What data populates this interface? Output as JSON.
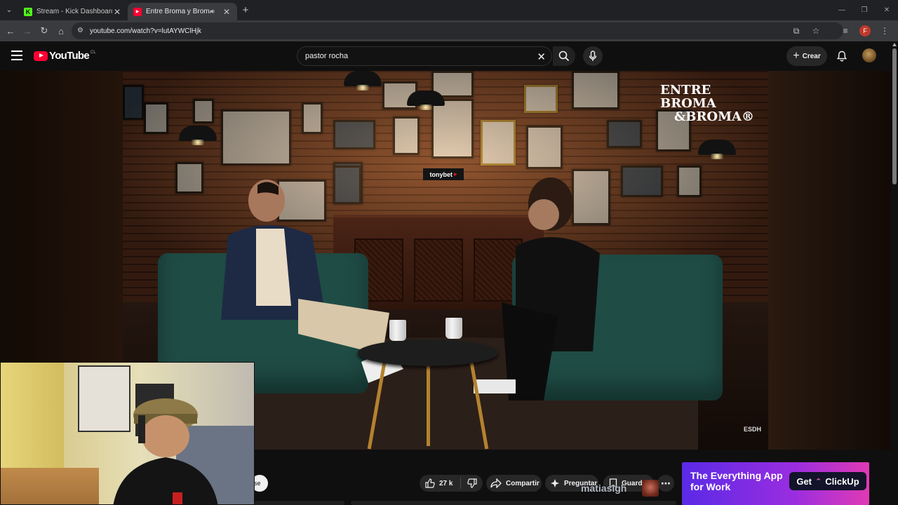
{
  "browser": {
    "tabs": [
      {
        "title": "Stream - Kick Dashboard",
        "favicon_color": "#53fc18",
        "favicon_letter": "K",
        "active": false
      },
      {
        "title": "Entre Broma y Broma | Past",
        "favicon_color": "#ff0033",
        "favicon_letter": "▶",
        "active": true
      }
    ],
    "new_tab": "+",
    "url": "youtube.com/watch?v=lutAYWClHjk",
    "profile_initial": "F"
  },
  "youtube": {
    "logo_text": "YouTube",
    "country_code": "CL",
    "search_value": "pastor rocha",
    "create_label": "Crear"
  },
  "video": {
    "brand_line1": "ENTRE",
    "brand_line2": "BROMA",
    "brand_line3": "&BROMA®",
    "sponsor": "tonybet",
    "corner_logo": "ESDH"
  },
  "actions": {
    "subscribe_fragment": "se",
    "likes": "27 k",
    "share": "Compartir",
    "ask": "Preguntar",
    "save": "Guarda",
    "more": "⋯"
  },
  "overlay": {
    "username": "matiaslgh"
  },
  "ad": {
    "text_line1": "The Everything App",
    "text_line2": "for Work",
    "cta_get": "Get",
    "cta_brand": "ClickUp"
  },
  "colors": {
    "youtube_red": "#ff0033",
    "kick_green": "#53fc18",
    "sofa_green": "#1f4c45"
  }
}
